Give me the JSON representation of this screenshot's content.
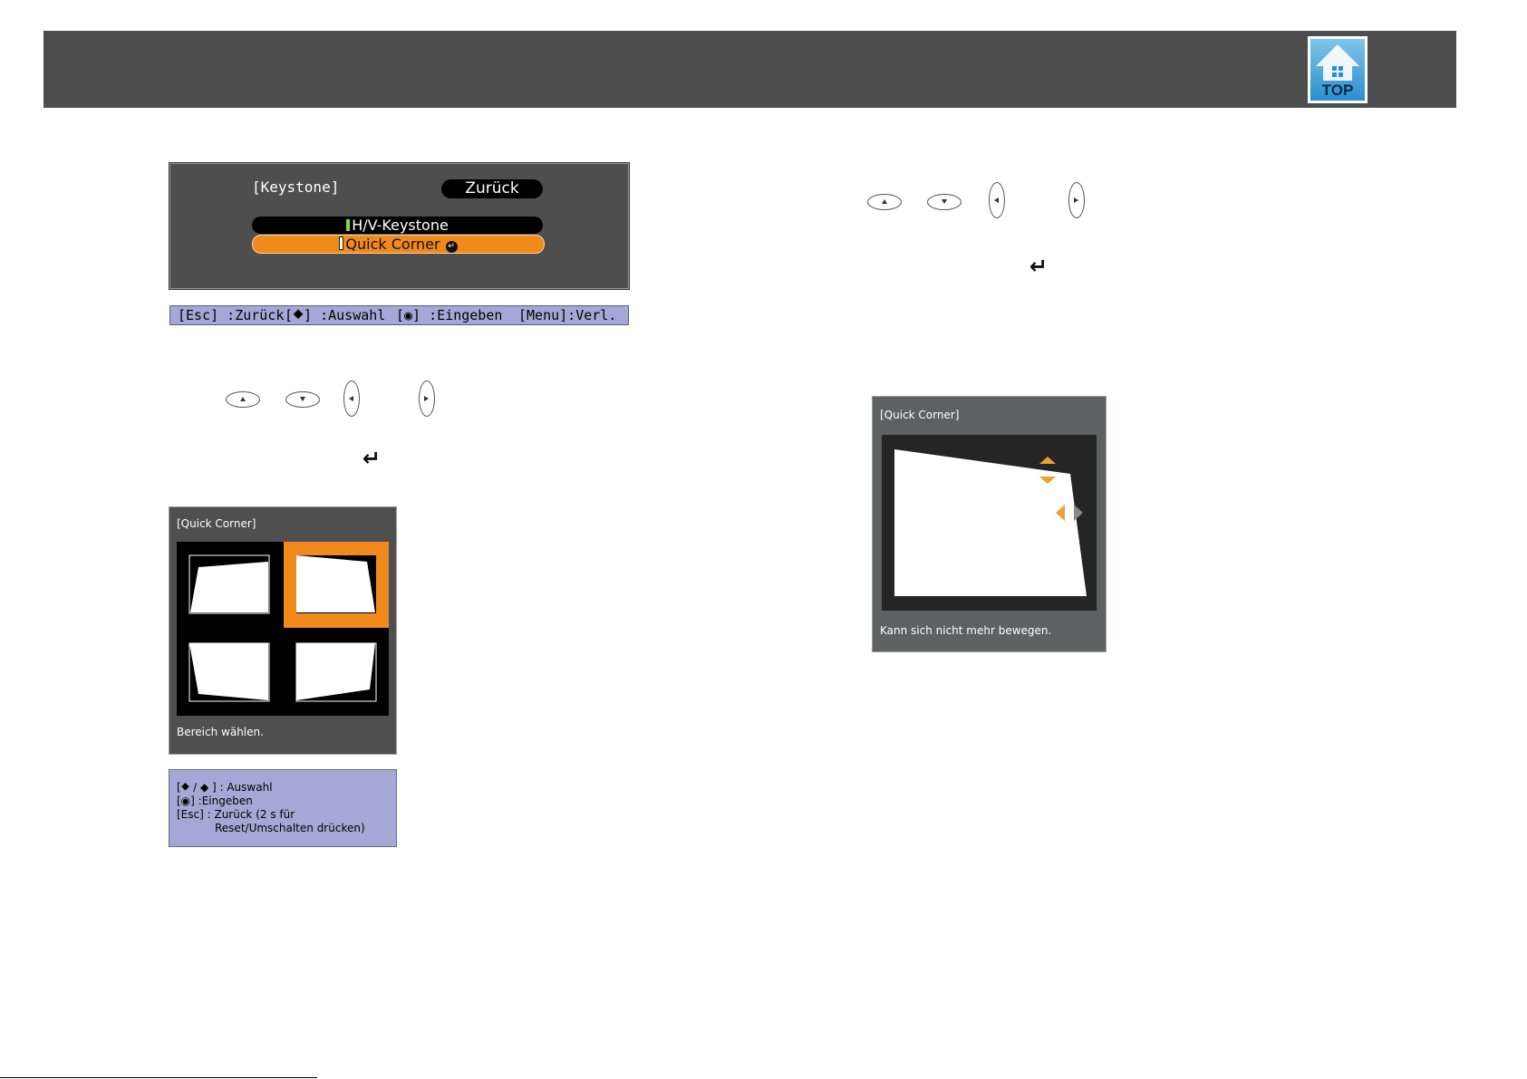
{
  "header": {
    "logo_text": "TOP"
  },
  "keystone_menu": {
    "title": "[Keystone]",
    "back_label": "Zurück",
    "items": [
      {
        "label": "H/V-Keystone",
        "state": "inactive"
      },
      {
        "label": "Quick Corner",
        "state": "selected"
      }
    ],
    "help": [
      "[Esc] :Zurück",
      "[⯁] :Auswahl",
      "[◉] :Eingeben",
      "[Menu]:Verl."
    ]
  },
  "quick_corner_select": {
    "title": "[Quick Corner]",
    "status": "Bereich wählen.",
    "selected_cell": "top-right",
    "help_lines": [
      "[⯁ / ◆ ] : Auswahl",
      "[◉] :Eingeben",
      "[Esc] : Zurück (2 s für",
      "Reset/Umschalten drücken)"
    ]
  },
  "quick_corner_adjust": {
    "title": "[Quick Corner]",
    "status": "Kann sich nicht mehr bewegen."
  },
  "colors": {
    "accent": "#f08a1c",
    "header": "#4d4d4d",
    "help_bg": "#a7a7d7"
  }
}
